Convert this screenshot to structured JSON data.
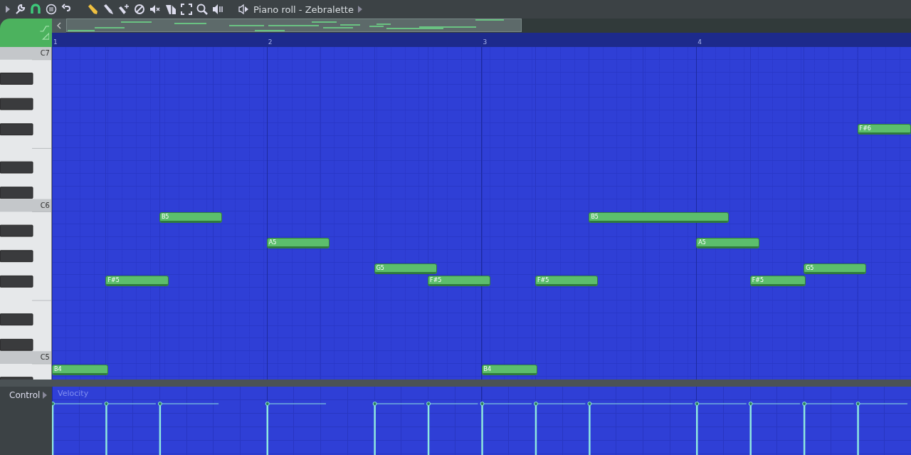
{
  "toolbar": {
    "title": "Piano roll - Zebralette"
  },
  "ruler": {
    "bars": [
      "1",
      "2",
      "3",
      "4"
    ]
  },
  "keyboard": {
    "labels": [
      "C7",
      "C6",
      "C5"
    ]
  },
  "notes": [
    {
      "label": "B4"
    },
    {
      "label": "F#5"
    },
    {
      "label": "B5"
    },
    {
      "label": "A5"
    },
    {
      "label": "G5"
    },
    {
      "label": "F#5"
    },
    {
      "label": "B4"
    },
    {
      "label": "F#5"
    },
    {
      "label": "B5"
    },
    {
      "label": "A5"
    },
    {
      "label": "F#5"
    },
    {
      "label": "G5"
    },
    {
      "label": "F#6"
    }
  ],
  "control": {
    "label": "Control",
    "parameter": "Velocity"
  }
}
